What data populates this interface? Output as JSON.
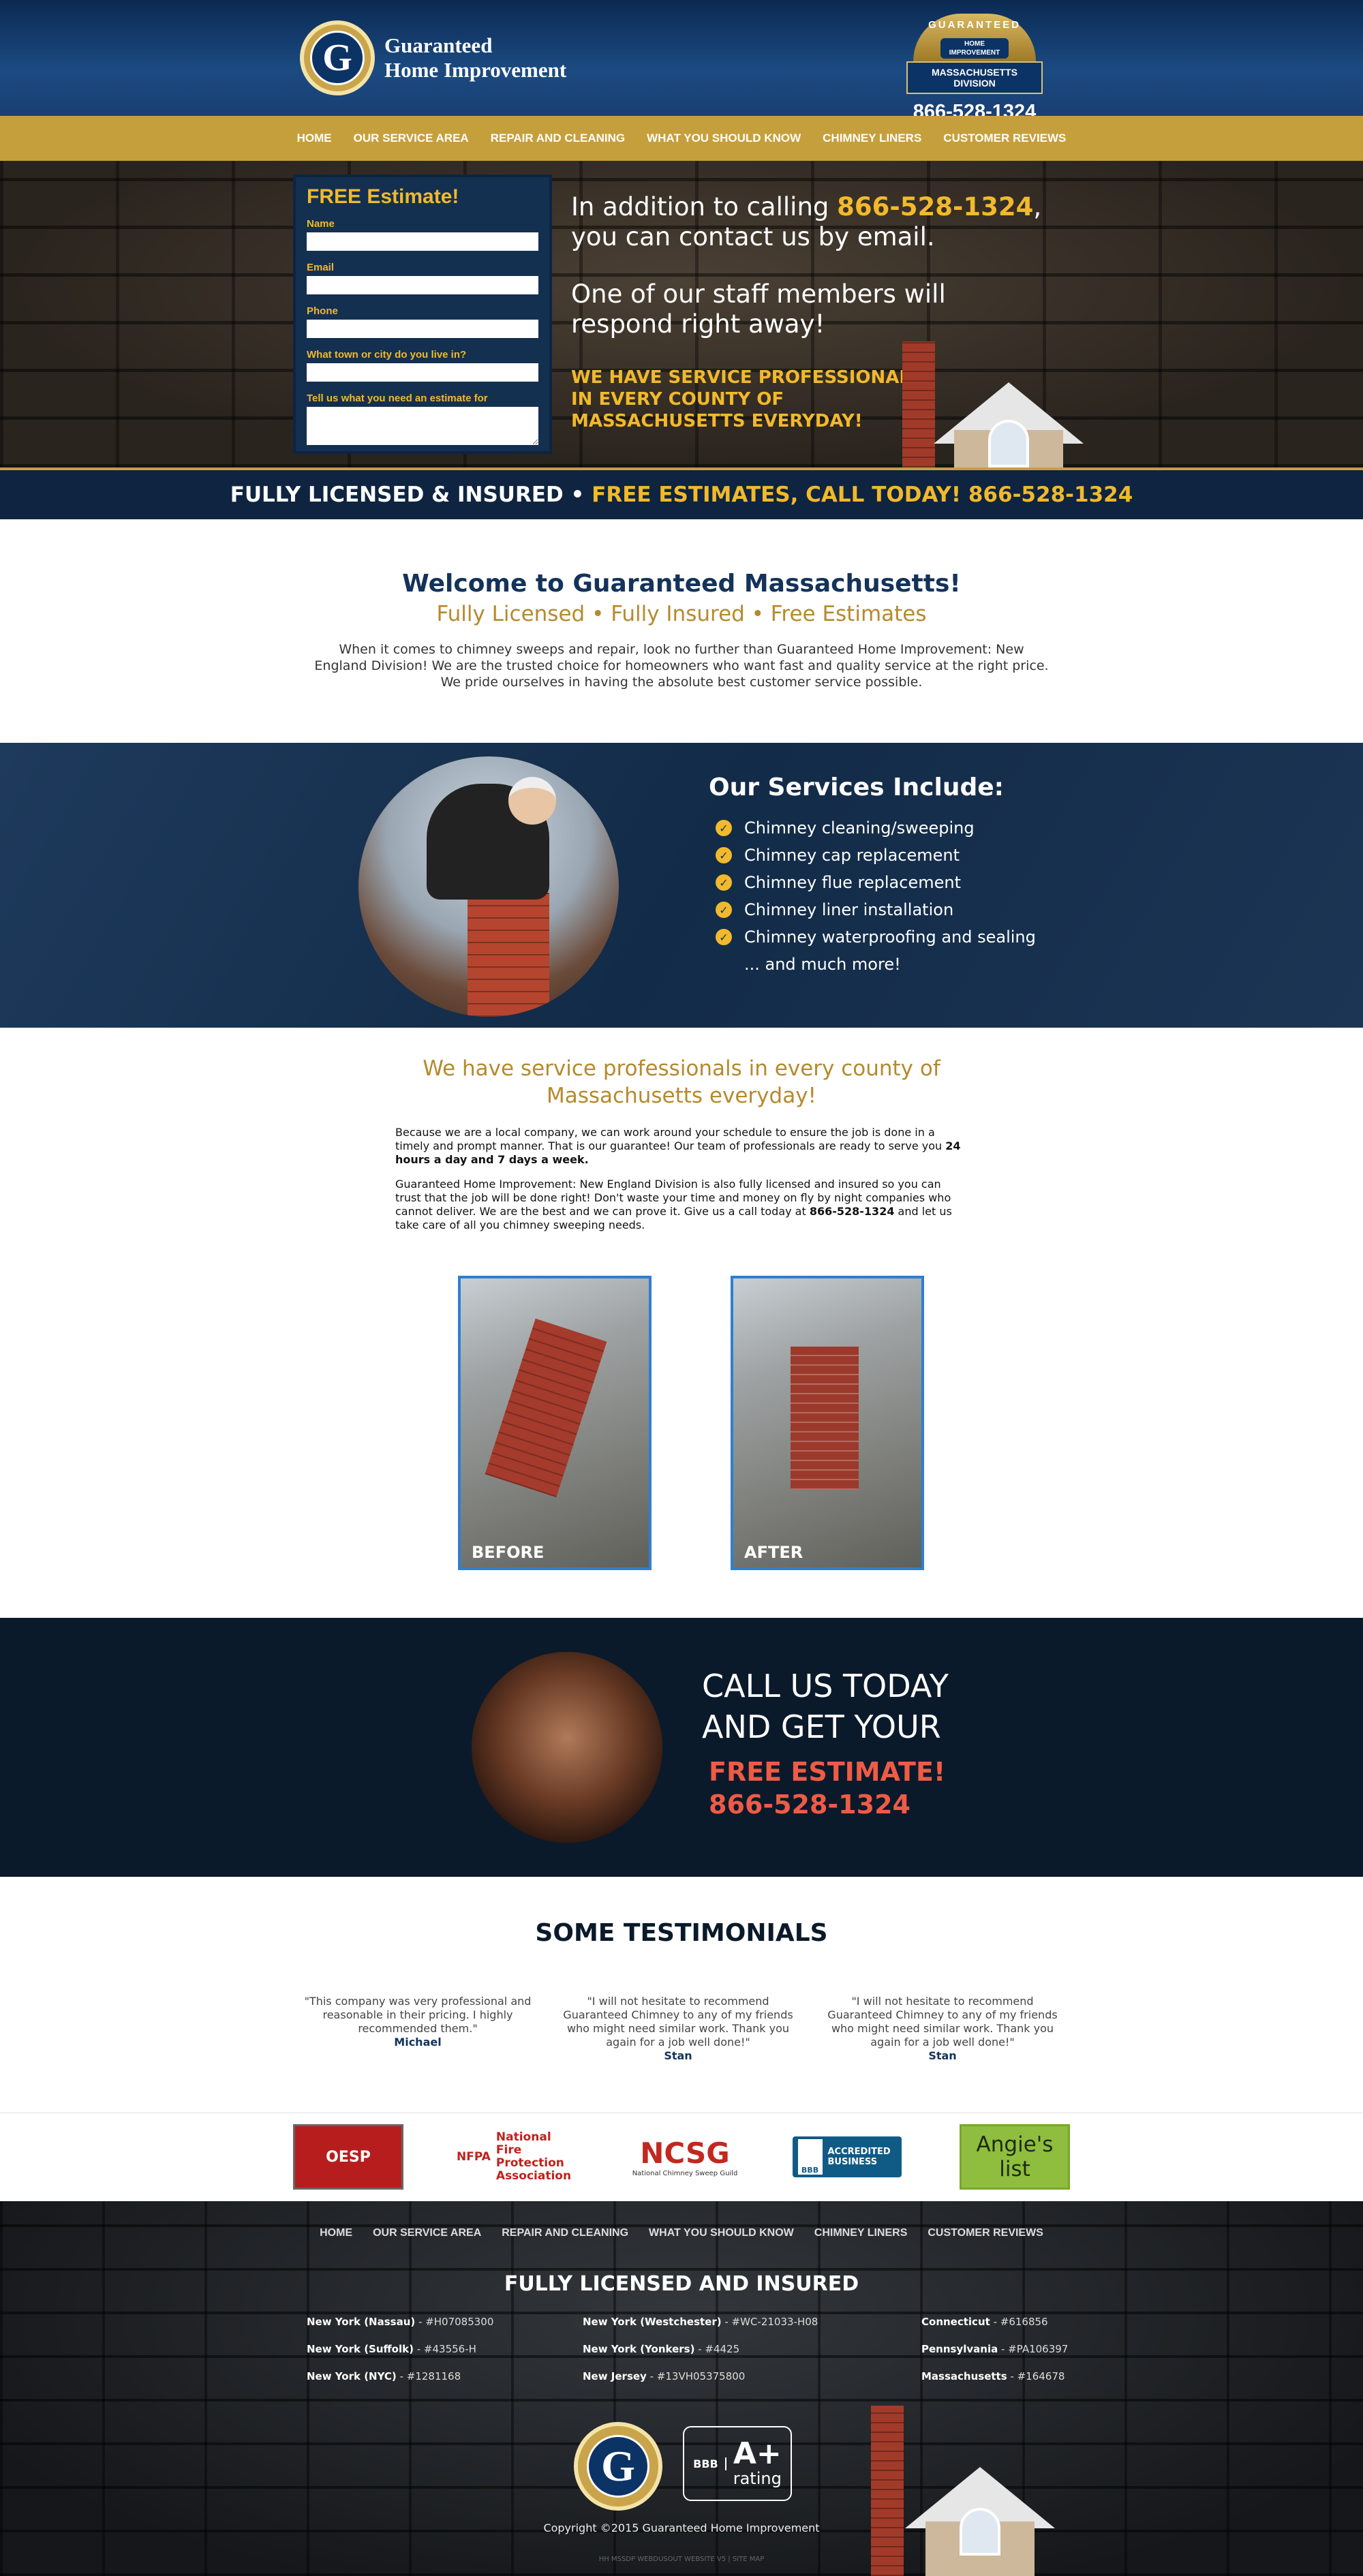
{
  "header": {
    "logo_line1": "Guaranteed",
    "logo_line2": "Home Improvement",
    "logo_letter": "G",
    "badge_top": "GUARANTEED",
    "badge_sub": "HOME IMPROVEMENT",
    "division": "MASSACHUSETTS DIVISION",
    "phone": "866-528-1324"
  },
  "nav": [
    "HOME",
    "OUR SERVICE AREA",
    "REPAIR AND CLEANING",
    "WHAT YOU SHOULD KNOW",
    "CHIMNEY LINERS",
    "CUSTOMER REVIEWS"
  ],
  "form": {
    "title": "FREE Estimate!",
    "fields": [
      "Name",
      "Email",
      "Phone",
      "What town or city do you live in?",
      "Tell us what you need an estimate for"
    ]
  },
  "hero": {
    "line1_pre": "In addition to calling ",
    "line1_phone": "866-528-1324",
    "line1_post": ", you can contact us by email.",
    "line2": "One of our staff members will respond right away!",
    "yellow": "WE HAVE SERVICE PROFESSIONALS IN EVERY COUNTY OF MASSACHUSETTS EVERYDAY!"
  },
  "strip": {
    "white": "FULLY LICENSED & INSURED • ",
    "yellow": "FREE ESTIMATES, CALL TODAY! 866-528-1324"
  },
  "welcome": {
    "title": "Welcome to Guaranteed Massachusetts!",
    "subtitle": "Fully Licensed • Fully Insured • Free Estimates",
    "body": "When it comes to chimney sweeps and repair, look no further than Guaranteed Home Improvement: New England Division! We are the trusted choice for homeowners who want fast and quality service at the right price. We pride ourselves in having the absolute best customer service possible."
  },
  "services": {
    "title": "Our Services Include:",
    "items": [
      "Chimney cleaning/sweeping",
      "Chimney cap replacement",
      "Chimney flue replacement",
      "Chimney liner installation",
      "Chimney waterproofing and sealing"
    ],
    "more": "... and much more!",
    "check_glyph": "✓"
  },
  "pros": {
    "title": "We have service professionals in every county of Massachusetts everyday!",
    "p1": "Because we are a local company, we can work around your schedule to ensure the job is done in a timely and prompt manner. That is our guarantee! Our team of professionals are ready to serve you ",
    "p1_bold": "24 hours a day and 7 days a week.",
    "p2_pre": "Guaranteed Home Improvement: New England Division is also fully licensed and insured so you can trust that the job will be done right! Don't waste your time and money on fly by night companies who cannot deliver. We are the best and we can prove it. Give us a call today at ",
    "p2_bold": "866-528-1324",
    "p2_post": " and let us take care of all you chimney sweeping needs.",
    "before": "BEFORE",
    "after": "AFTER"
  },
  "call": {
    "line1": "CALL US TODAY",
    "line2": "AND GET YOUR",
    "line3": "FREE ESTIMATE!",
    "phone": "866-528-1324"
  },
  "testimonials": {
    "title": "SOME TESTIMONIALS",
    "items": [
      {
        "text": "\"This company was very professional and reasonable in their pricing. I highly recommended them.\"",
        "who": "Michael"
      },
      {
        "text": "\"I will not hesitate to recommend Guaranteed Chimney to any of my friends who might need similar work. Thank you again for a job well done!\"",
        "who": "Stan"
      },
      {
        "text": "\"I will not hesitate to recommend Guaranteed Chimney to any of my friends who might need similar work. Thank you again for a job well done!\"",
        "who": "Stan"
      }
    ]
  },
  "partners": {
    "oesp": "OESP",
    "nfpa_line1": "National Fire",
    "nfpa_line2": "Protection",
    "nfpa_line3": "Association",
    "nfpa_short": "NFPA",
    "ncsg": "NCSG",
    "ncsg_sub": "National Chimney Sweep Guild",
    "bbb_mark": "BBB",
    "bbb_text1": "ACCREDITED",
    "bbb_text2": "BUSINESS",
    "angie": "Angie's list"
  },
  "footer": {
    "nav": [
      "HOME",
      "OUR SERVICE AREA",
      "REPAIR AND CLEANING",
      "WHAT YOU SHOULD KNOW",
      "CHIMNEY LINERS",
      "CUSTOMER REVIEWS"
    ],
    "lic_title": "FULLY LICENSED AND INSURED",
    "licenses": [
      {
        "state": "New York (Nassau)",
        "num": " - #H07085300"
      },
      {
        "state": "New York (Suffolk)",
        "num": " - #43556-H"
      },
      {
        "state": "New York (NYC)",
        "num": " - #1281168"
      },
      {
        "state": "New York (Westchester)",
        "num": " - #WC-21033-H08"
      },
      {
        "state": "New York (Yonkers)",
        "num": " - #4425"
      },
      {
        "state": "New Jersey",
        "num": " - #13VH05375800"
      },
      {
        "state": "Connecticut",
        "num": " - #616856"
      },
      {
        "state": "Pennsylvania",
        "num": " - #PA106397"
      },
      {
        "state": "Massachusetts",
        "num": " - #164678"
      }
    ],
    "bbb_left": "BBB",
    "bbb_aplus": "A+",
    "bbb_rating": "rating",
    "copyright": "Copyright ©2015 Guaranteed Home Improvement",
    "tiny": "HH MSSDP WEBDUSOUT WEBSITE V5  |  SITE MAP"
  }
}
